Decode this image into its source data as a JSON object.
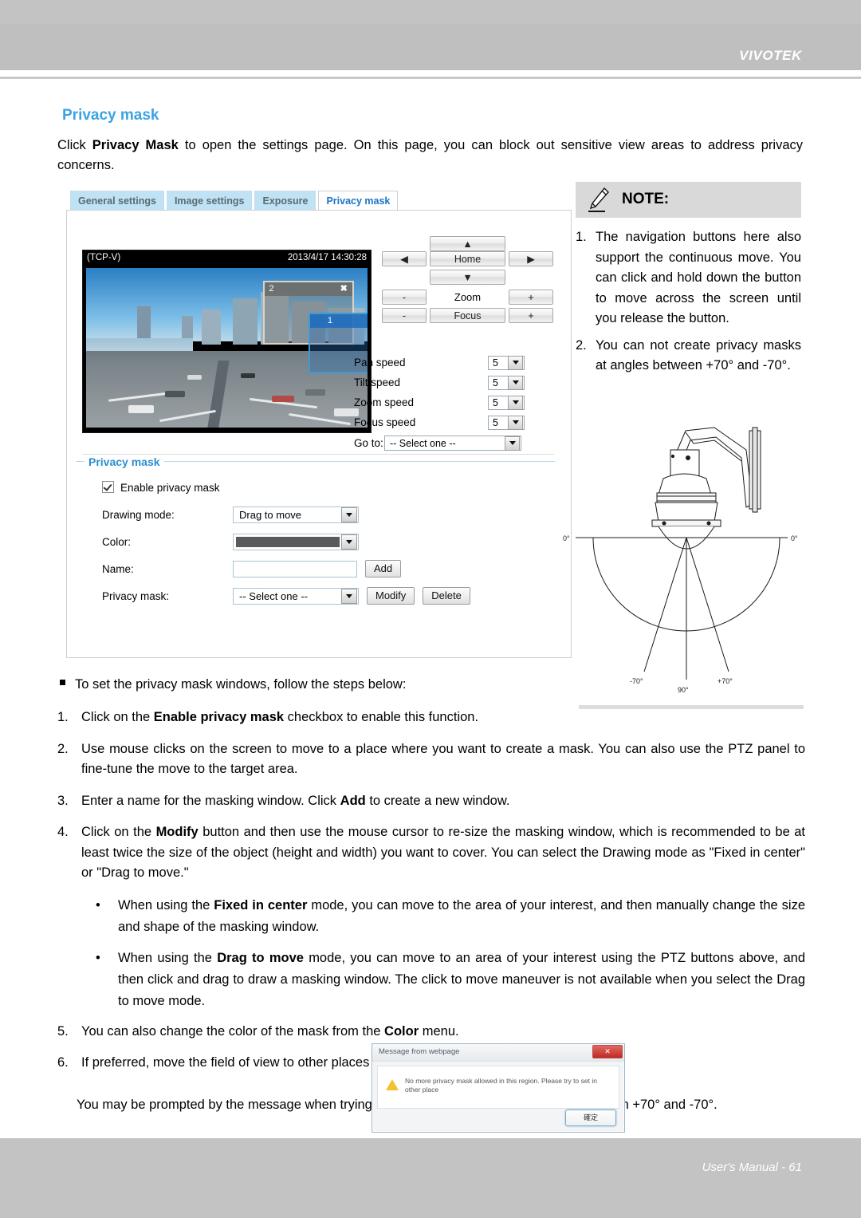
{
  "header": {
    "brand": "VIVOTEK"
  },
  "footer": {
    "text": "User's Manual - 61"
  },
  "section": {
    "title": "Privacy mask",
    "intro_prefix": "Click ",
    "intro_bold": "Privacy Mask",
    "intro_suffix": " to open the settings page. On this page, you can block out sensitive view areas to address privacy concerns."
  },
  "tabs": [
    {
      "label": "General settings",
      "active": false
    },
    {
      "label": "Image settings",
      "active": false
    },
    {
      "label": "Exposure",
      "active": false
    },
    {
      "label": "Privacy mask",
      "active": true
    }
  ],
  "video": {
    "stream_label": "(TCP-V)",
    "timestamp": "2013/4/17 14:30:28",
    "masks": [
      {
        "id": "2",
        "close": "✖",
        "color": "#6e6c68"
      },
      {
        "id": "1",
        "close": "✖",
        "color": "#1e6ebe"
      }
    ]
  },
  "ptz": {
    "up": "▲",
    "left": "◀",
    "home": "Home",
    "right": "▶",
    "down": "▼",
    "minus": "-",
    "plus": "+",
    "zoom_label": "Zoom",
    "focus_label": "Focus",
    "speeds": [
      {
        "label": "Pan speed",
        "value": "5"
      },
      {
        "label": "Tilt speed",
        "value": "5"
      },
      {
        "label": "Zoom speed",
        "value": "5"
      },
      {
        "label": "Focus speed",
        "value": "5"
      }
    ],
    "goto_label": "Go to:",
    "goto_value": "-- Select one --"
  },
  "privacy_form": {
    "legend": "Privacy mask",
    "enable_label": "Enable privacy mask",
    "enable_checked": true,
    "drawing_mode_label": "Drawing mode:",
    "drawing_mode_value": "Drag to move",
    "color_label": "Color:",
    "color_value": "#5a5a5a",
    "name_label": "Name:",
    "name_value": "",
    "add_label": "Add",
    "mask_label": "Privacy mask:",
    "mask_value": "-- Select one --",
    "modify_label": "Modify",
    "delete_label": "Delete"
  },
  "note": {
    "title": "NOTE:",
    "items": [
      {
        "num": "1.",
        "text": "The navigation buttons here also support the continuous move. You can click and hold down the button to move across the screen until you release the button."
      },
      {
        "num": "2.",
        "text": "You can not create privacy masks at angles between +70° and -70°."
      }
    ]
  },
  "diagram": {
    "labels": {
      "left_zero": "0°",
      "right_zero": "0°",
      "minus70": "-70°",
      "ninety": "90°",
      "plus70": "+70°"
    }
  },
  "steps": {
    "lead": "To set the privacy mask windows, follow the steps below:",
    "items": [
      {
        "num": "1.",
        "pre": "Click on the ",
        "bold": "Enable privacy mask",
        "post": " checkbox to enable this function."
      },
      {
        "num": "2.",
        "pre": "Use mouse clicks on the screen to move to a place where you want to create a mask. You can also use the PTZ panel to fine-tune the move to the target area.",
        "bold": "",
        "post": ""
      },
      {
        "num": "3.",
        "pre": "Enter a name for the masking window. Click ",
        "bold": "Add",
        "post": " to create a new window."
      },
      {
        "num": "4.",
        "pre": "Click on the ",
        "bold": "Modify",
        "post": " button and then use the mouse cursor to re-size the masking window, which is recommended to be at least twice the size of the object (height and width) you want to cover. You can select the Drawing mode as \"Fixed in center\" or \"Drag to move.\""
      }
    ],
    "subs": [
      {
        "dot": "•",
        "pre": "When using the ",
        "bold": "Fixed in center",
        "post": " mode, you can move to the area of your interest, and then manually change the size and shape of the masking window."
      },
      {
        "dot": "•",
        "pre": "When using the ",
        "bold": "Drag to move",
        "post": " mode, you can move to an area of your interest using the PTZ buttons above, and then click and drag to draw a masking window. The click to move maneuver is not available when you select the Drag to move mode."
      }
    ],
    "items_tail": [
      {
        "num": "5.",
        "pre": "You can also change the color of the mask from the ",
        "bold": "Color",
        "post": " menu."
      },
      {
        "num": "6.",
        "pre": "If preferred, move the field of view to other places to create more privacy masks.",
        "bold": "",
        "post": ""
      }
    ],
    "closing": "You may be prompted by the message when trying to create a privacy mask at angles between +70° and -70°."
  },
  "dialog": {
    "title": "Message from webpage",
    "close_label": "✕",
    "message": "No more privacy mask allowed in this region. Please try to set in other place",
    "ok_label": "確定"
  }
}
